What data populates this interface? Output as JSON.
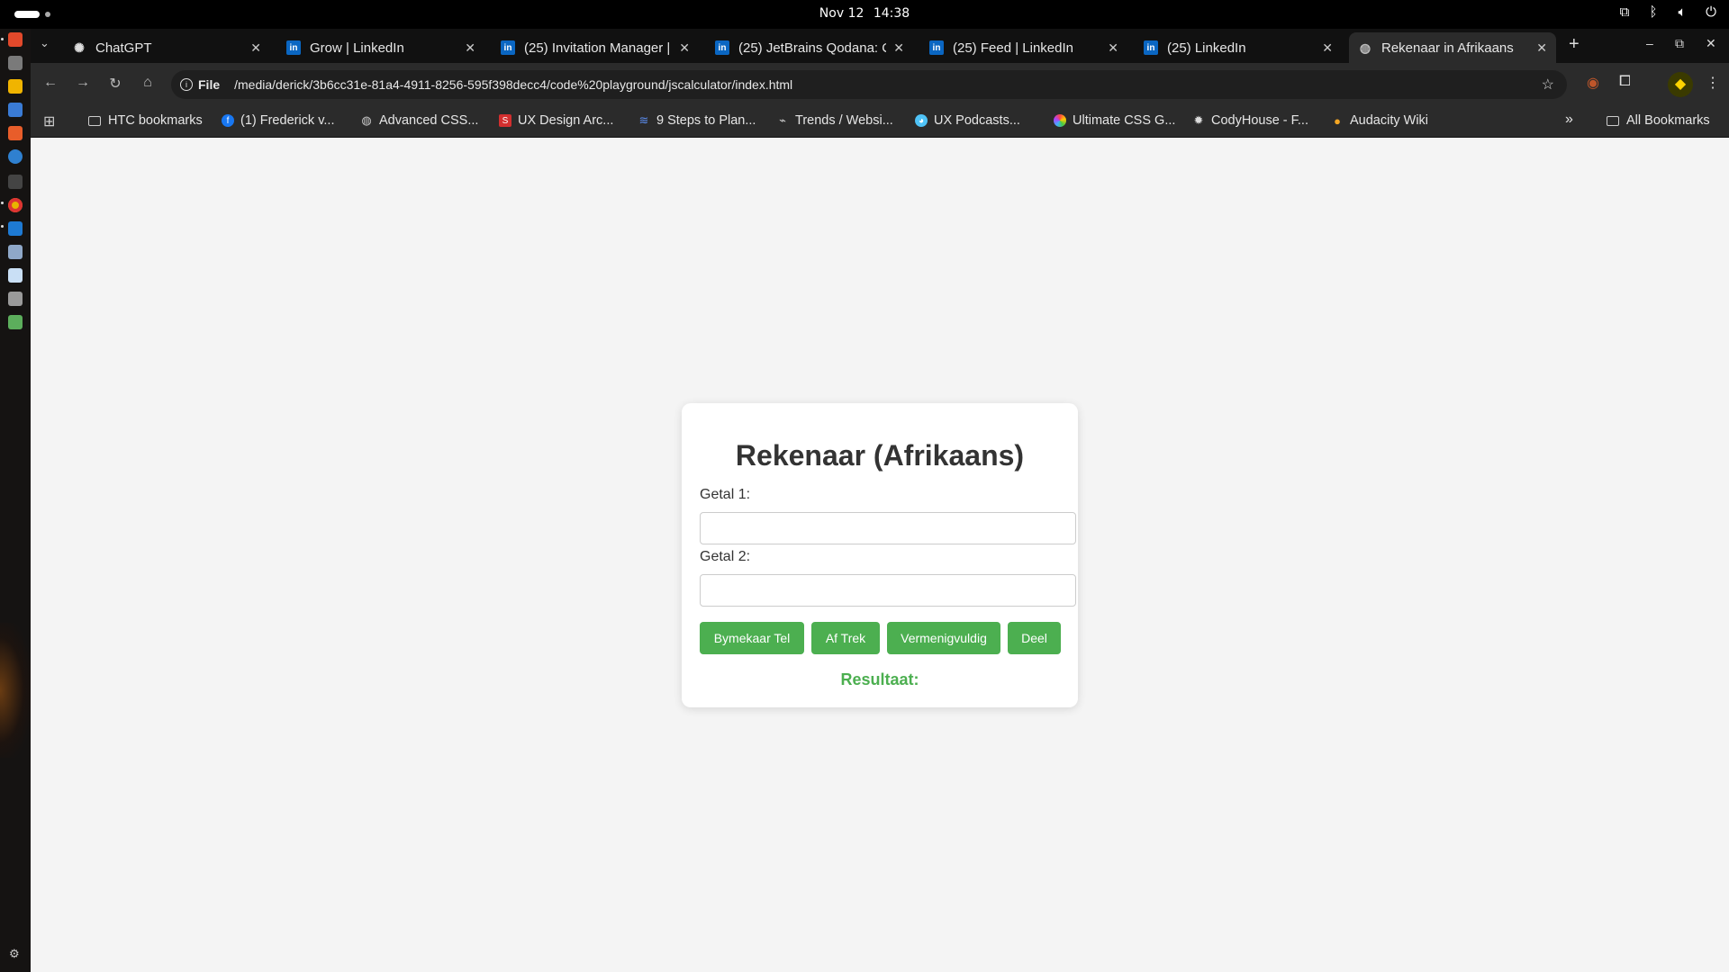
{
  "system": {
    "date": "Nov 12",
    "time": "14:38"
  },
  "tabs": [
    {
      "title": "ChatGPT",
      "favicon": "chatgpt-icon"
    },
    {
      "title": "Grow | LinkedIn",
      "favicon": "linkedin-icon"
    },
    {
      "title": "(25) Invitation Manager |",
      "favicon": "linkedin-icon"
    },
    {
      "title": "(25) JetBrains Qodana: C",
      "favicon": "linkedin-icon"
    },
    {
      "title": "(25) Feed | LinkedIn",
      "favicon": "linkedin-icon"
    },
    {
      "title": "(25) LinkedIn",
      "favicon": "linkedin-icon"
    },
    {
      "title": "Rekenaar in Afrikaans",
      "favicon": "globe-icon",
      "active": true
    }
  ],
  "address": {
    "chip": "File",
    "url": "/media/derick/3b6cc31e-81a4-4911-8256-595f398decc4/code%20playground/jscalculator/index.html"
  },
  "bookmarks": [
    "HTC bookmarks",
    "(1) Frederick v...",
    "Advanced CSS...",
    "UX Design Arc...",
    "9 Steps to Plan...",
    "Trends / Websi...",
    "UX Podcasts...",
    "Ultimate CSS G...",
    "CodyHouse - F...",
    "Audacity Wiki"
  ],
  "all_bookmarks": "All Bookmarks",
  "calculator": {
    "title": "Rekenaar (Afrikaans)",
    "label1": "Getal 1:",
    "label2": "Getal 2:",
    "value1": "",
    "value2": "",
    "buttons": [
      "Bymekaar Tel",
      "Af Trek",
      "Vermenigvuldig",
      "Deel"
    ],
    "result_label": "Resultaat:"
  },
  "colors": {
    "accent": "#4caf50",
    "page_bg": "#f4f4f4",
    "chrome_bg": "#2b2b2b",
    "linkedin": "#0a66c2"
  }
}
